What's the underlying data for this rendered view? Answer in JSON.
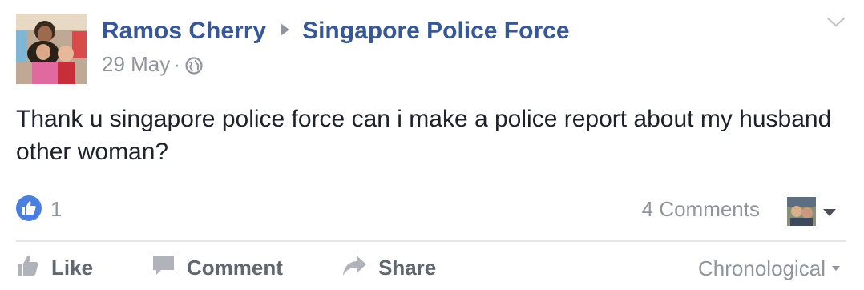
{
  "post": {
    "author": "Ramos Cherry",
    "target_page": "Singapore Police Force",
    "date": "29 May",
    "separator": "·",
    "privacy_icon": "globe-icon",
    "message": "Thank u singapore police force can i make a police report about my husband other woman?"
  },
  "reactions": {
    "like_icon": "thumbs-up-icon",
    "like_count": "1",
    "comments_label": "4 Comments"
  },
  "actions": {
    "like_label": "Like",
    "comment_label": "Comment",
    "share_label": "Share",
    "sort_label": "Chronological"
  },
  "colors": {
    "link": "#365899",
    "muted": "#90949c",
    "text": "#1d2129",
    "like_blue": "#4a7fe0",
    "action_gray": "#606770"
  }
}
